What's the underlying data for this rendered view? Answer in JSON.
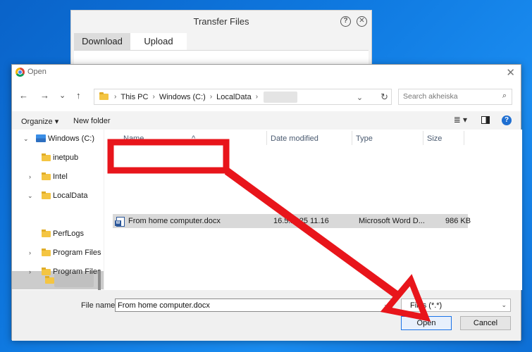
{
  "transfer_window": {
    "title": "Transfer Files",
    "help_glyph": "?",
    "close_glyph": "✕",
    "tabs": [
      {
        "label": "Download",
        "active": false
      },
      {
        "label": "Upload",
        "active": true
      }
    ]
  },
  "dialog": {
    "title": "Open",
    "close_glyph": "✕",
    "nav": {
      "back": "←",
      "forward": "→",
      "recent": "⌄",
      "up": "↑"
    },
    "breadcrumb": [
      "This PC",
      "Windows (C:)",
      "LocalData"
    ],
    "breadcrumb_sep": "›",
    "refresh_glyph": "↻",
    "dropdown_glyph": "⌄",
    "search_placeholder": "Search akheiska",
    "search_glyph": "⌕",
    "commands": {
      "organize": "Organize ▾",
      "new_folder": "New folder",
      "view_glyph": "≣ ▾",
      "help_glyph": "?"
    },
    "tree": [
      {
        "label": "Windows (C:)",
        "chevron": "⌄",
        "kind": "drive"
      },
      {
        "label": "inetpub",
        "chevron": "",
        "kind": "folder"
      },
      {
        "label": "Intel",
        "chevron": "›",
        "kind": "folder"
      },
      {
        "label": "LocalData",
        "chevron": "⌄",
        "kind": "folder"
      },
      {
        "label": "",
        "chevron": "",
        "kind": "folder",
        "selected": true
      },
      {
        "label": "PerfLogs",
        "chevron": "",
        "kind": "folder"
      },
      {
        "label": "Program Files",
        "chevron": "›",
        "kind": "folder"
      },
      {
        "label": "Program Files",
        "chevron": "›",
        "kind": "folder"
      }
    ],
    "columns": {
      "name": "Name",
      "date": "Date modified",
      "type": "Type",
      "size": "Size",
      "sort_glyph": "^"
    },
    "files": [
      {
        "name": "From home computer.docx",
        "date": "16.5.2025 11.16",
        "type": "Microsoft Word D...",
        "size": "986 KB"
      }
    ],
    "file_name_label": "File name:",
    "file_name_value": "From home computer.docx",
    "file_type_value": "Files (*.*)",
    "open_label": "Open",
    "cancel_label": "Cancel"
  },
  "colors": {
    "annotation_red": "#e8151b",
    "accent": "#1a73e8"
  }
}
